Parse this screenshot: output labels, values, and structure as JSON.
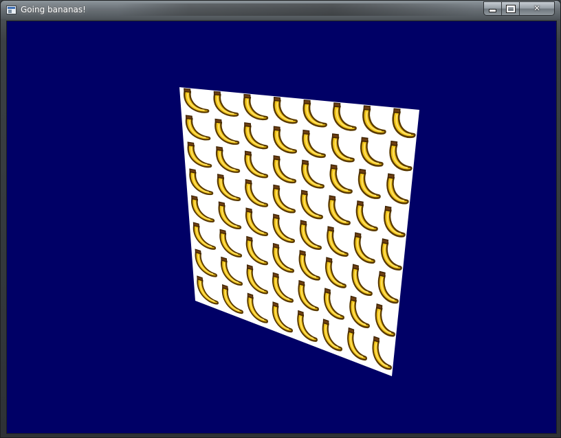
{
  "window": {
    "title": "Going bananas!",
    "icon": "app-window-icon",
    "buttons": {
      "minimize": "minimize-icon",
      "maximize": "maximize-icon",
      "close_label": "✕"
    }
  },
  "scene": {
    "background_color": "#000066",
    "quad_color": "#ffffff",
    "tile_grid": {
      "rows": 8,
      "cols": 8
    },
    "tile_sprite": "banana-icon",
    "banana_colors": {
      "fill": "#f0c419",
      "highlight": "#ffe066",
      "outline": "#5a3a00",
      "stem": "#6b3e12"
    }
  }
}
